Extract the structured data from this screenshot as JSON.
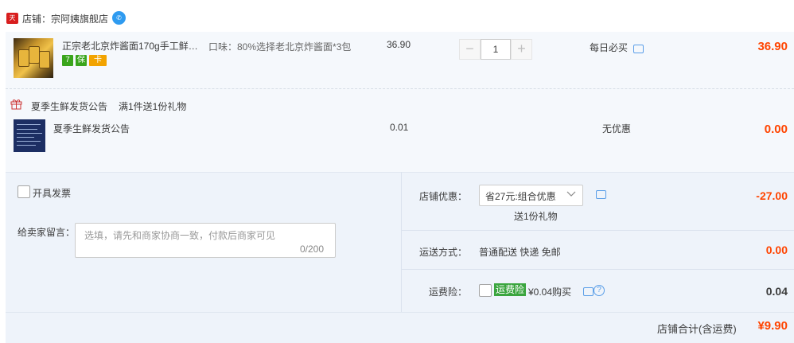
{
  "shop": {
    "badge": "天猫",
    "name": "店铺：宗阿姨旗舰店"
  },
  "item1": {
    "title": "正宗老北京炸酱面170g手工鲜…",
    "sku": "口味：80%选择老北京炸酱面*3包",
    "price": "36.90",
    "quantity": "1",
    "minus": "−",
    "plus": "+",
    "promo": "每日必买",
    "subtotal": "36.90",
    "service_icons": [
      "7",
      "保",
      "卡"
    ]
  },
  "gift": {
    "title": "夏季生鲜发货公告",
    "desc": "满1件送1份礼物"
  },
  "item2": {
    "title": "夏季生鲜发货公告",
    "price": "0.01",
    "promo": "无优惠",
    "subtotal": "0.00"
  },
  "invoice": {
    "label": "开具发票"
  },
  "message": {
    "label": "给卖家留言：",
    "placeholder": "选填，请先和商家协商一致，付款后商家可见",
    "count": "0/200"
  },
  "discount": {
    "label": "店铺优惠：",
    "selected": "省27元:组合优惠",
    "note": "送1份礼物",
    "amount": "-27.00"
  },
  "shipping": {
    "label": "运送方式：",
    "value": "普通配送 快递 免邮",
    "amount": "0.00"
  },
  "insurance": {
    "label": "运费险：",
    "badge": "运费险",
    "price": "¥0.04购买",
    "amount": "0.04"
  },
  "total": {
    "label": "店铺合计(含运费)",
    "amount": "¥9.90"
  },
  "colors": {
    "price_red": "#ff4400",
    "panel_bg": "#eef3fa",
    "item_bg": "#f5f8fc"
  }
}
